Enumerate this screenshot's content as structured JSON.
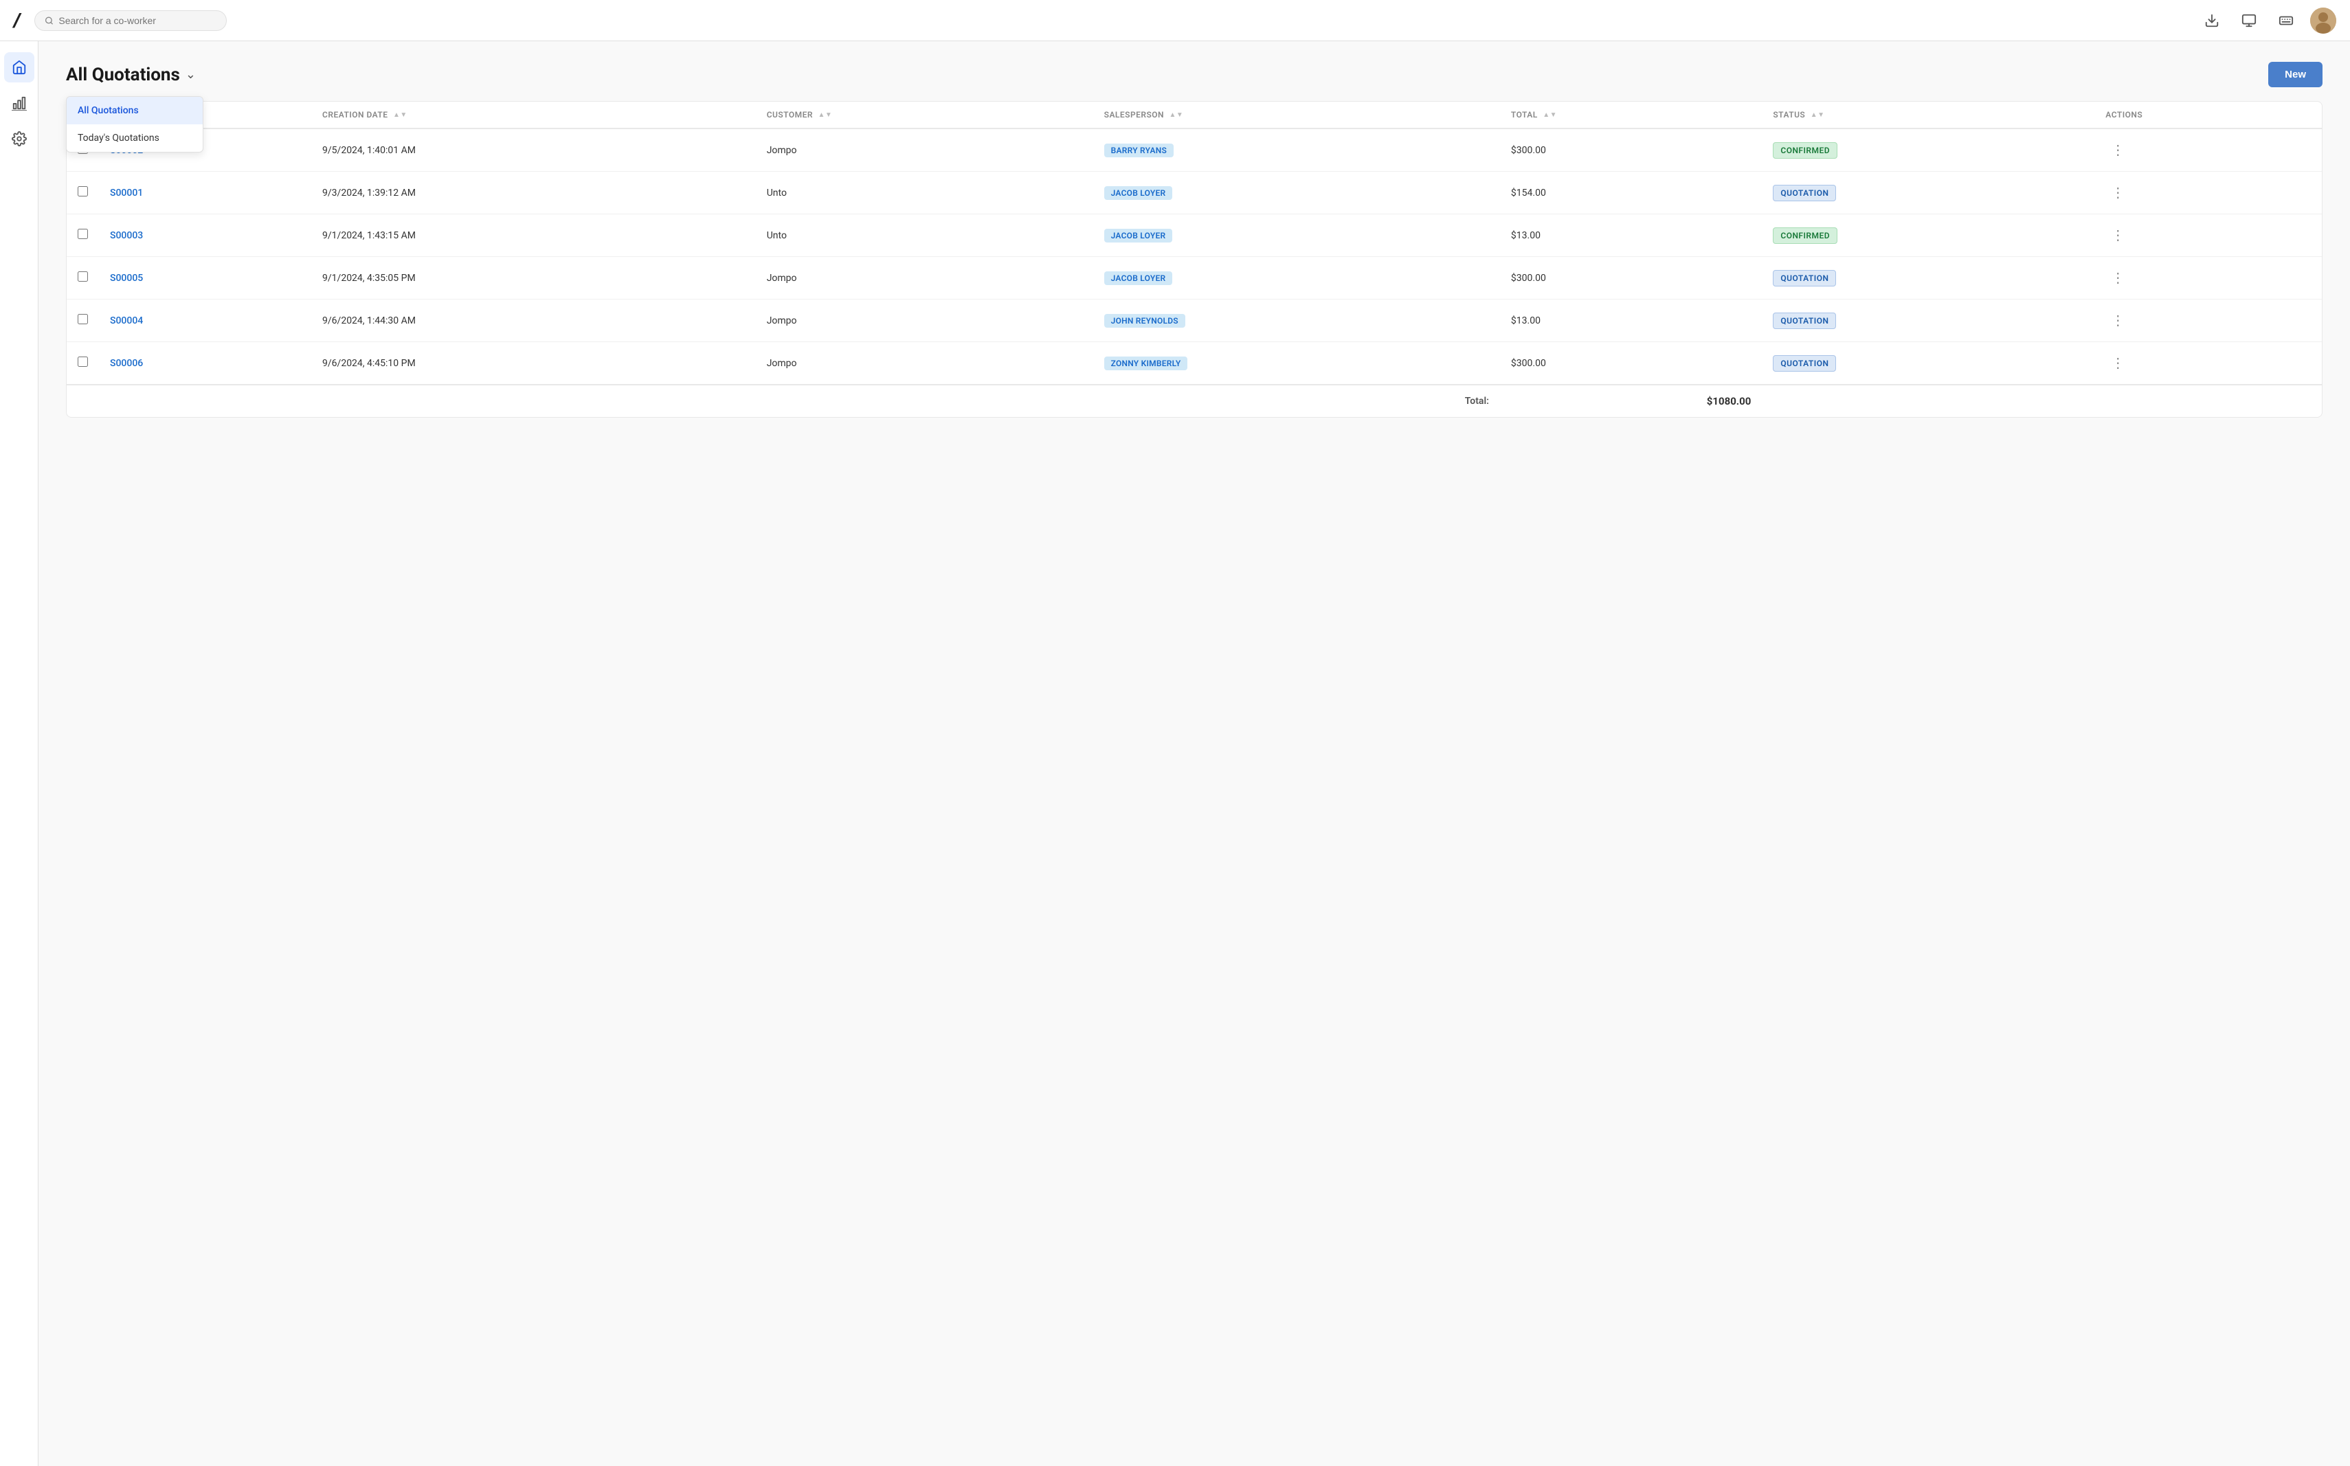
{
  "navbar": {
    "logo": "/",
    "search_placeholder": "Search for a co-worker"
  },
  "sidebar": {
    "items": [
      {
        "icon": "home",
        "label": "Home",
        "active": true
      },
      {
        "icon": "chart",
        "label": "Analytics",
        "active": false
      },
      {
        "icon": "settings",
        "label": "Settings",
        "active": false
      }
    ]
  },
  "page": {
    "title": "All Quotations",
    "new_button": "New"
  },
  "dropdown": {
    "items": [
      {
        "label": "All Quotations",
        "active": true
      },
      {
        "label": "Today's Quotations",
        "active": false
      }
    ]
  },
  "table": {
    "columns": [
      {
        "key": "order_id",
        "label": ""
      },
      {
        "key": "creation_date",
        "label": "CREATION DATE",
        "sortable": true
      },
      {
        "key": "customer",
        "label": "CUSTOMER",
        "sortable": true
      },
      {
        "key": "salesperson",
        "label": "SALESPERSON",
        "sortable": true
      },
      {
        "key": "total",
        "label": "TOTAL",
        "sortable": true
      },
      {
        "key": "status",
        "label": "STATUS",
        "sortable": true
      },
      {
        "key": "actions",
        "label": "ACTIONS"
      }
    ],
    "rows": [
      {
        "id": "S00002",
        "creation_date": "9/5/2024, 1:40:01 AM",
        "customer": "Jompo",
        "salesperson": "BARRY RYANS",
        "total": "$300.00",
        "status": "CONFIRMED",
        "status_type": "confirmed"
      },
      {
        "id": "S00001",
        "creation_date": "9/3/2024, 1:39:12 AM",
        "customer": "Unto",
        "salesperson": "JACOB LOYER",
        "total": "$154.00",
        "status": "QUOTATION",
        "status_type": "quotation"
      },
      {
        "id": "S00003",
        "creation_date": "9/1/2024, 1:43:15 AM",
        "customer": "Unto",
        "salesperson": "JACOB LOYER",
        "total": "$13.00",
        "status": "CONFIRMED",
        "status_type": "confirmed"
      },
      {
        "id": "S00005",
        "creation_date": "9/1/2024, 4:35:05 PM",
        "customer": "Jompo",
        "salesperson": "JACOB LOYER",
        "total": "$300.00",
        "status": "QUOTATION",
        "status_type": "quotation"
      },
      {
        "id": "S00004",
        "creation_date": "9/6/2024, 1:44:30 AM",
        "customer": "Jompo",
        "salesperson": "JOHN REYNOLDS",
        "total": "$13.00",
        "status": "QUOTATION",
        "status_type": "quotation"
      },
      {
        "id": "S00006",
        "creation_date": "9/6/2024, 4:45:10 PM",
        "customer": "Jompo",
        "salesperson": "ZONNY KIMBERLY",
        "total": "$300.00",
        "status": "QUOTATION",
        "status_type": "quotation"
      }
    ],
    "total_label": "Total:",
    "total_amount": "$1080.00"
  }
}
